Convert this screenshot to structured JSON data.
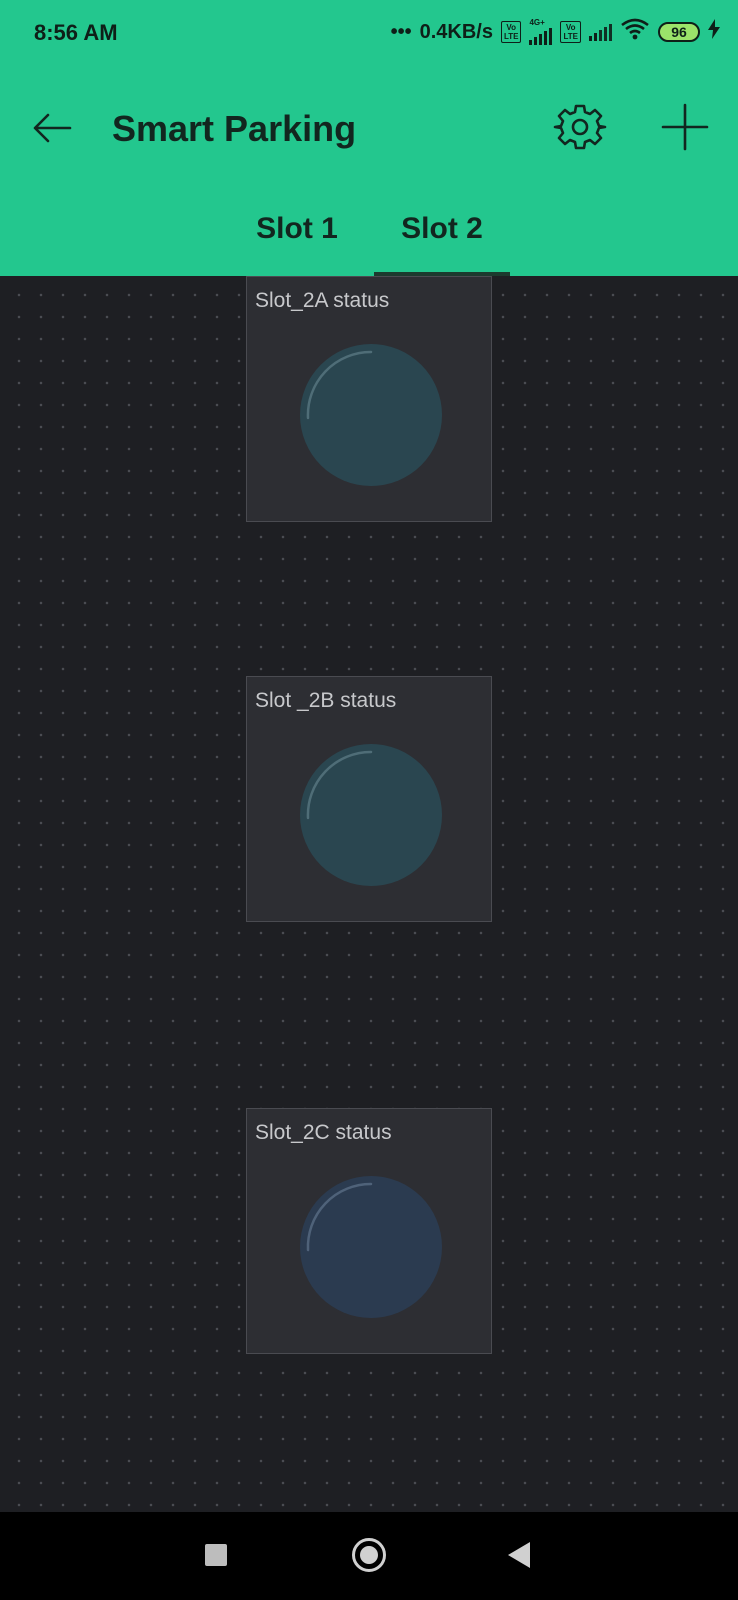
{
  "status_bar": {
    "time": "8:56 AM",
    "network_speed": "0.4KB/s",
    "volte_badge": "Vo\nLTE",
    "network_type": "4G+",
    "battery_level": "96"
  },
  "header": {
    "title": "Smart Parking",
    "icons": {
      "back": "arrow-left-icon",
      "settings": "gear-icon",
      "add": "plus-icon"
    }
  },
  "tabs": [
    {
      "label": "Slot 1",
      "selected": false
    },
    {
      "label": "Slot 2",
      "selected": true
    }
  ],
  "widgets": [
    {
      "label": "Slot_2A status",
      "led_color": "#2a4650"
    },
    {
      "label": "Slot _2B status",
      "led_color": "#2a4650"
    },
    {
      "label": "Slot_2C status",
      "led_color": "#2b3b50"
    }
  ],
  "colors": {
    "accent": "#23c78e",
    "background": "#1e1f23",
    "widget_bg": "#2d2e33"
  }
}
